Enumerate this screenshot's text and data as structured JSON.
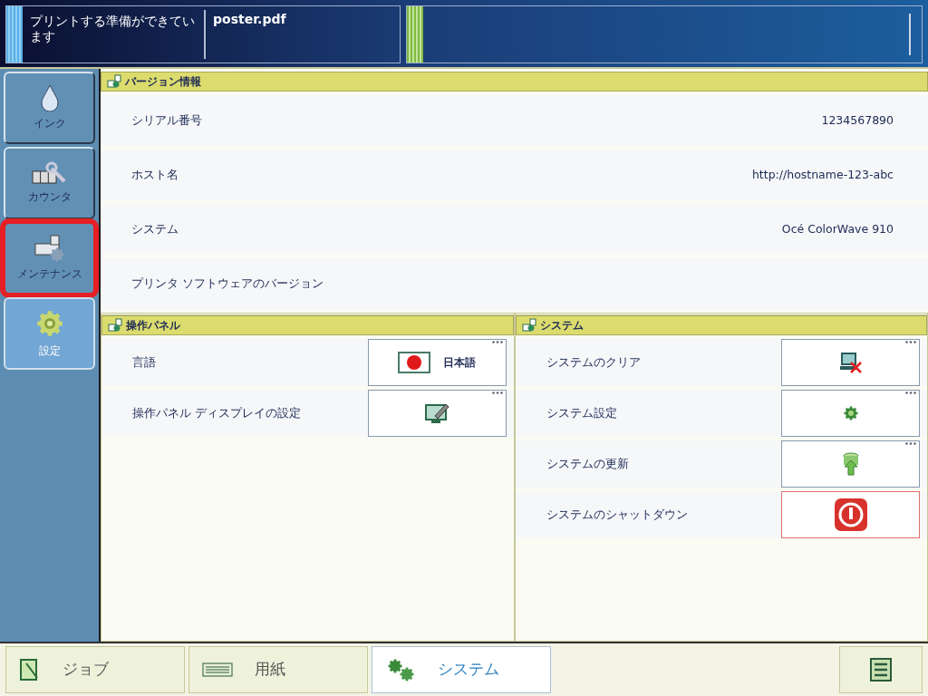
{
  "status_panel": {
    "message": "プリントする準備ができています",
    "job": "poster.pdf"
  },
  "sidebar": {
    "items": [
      {
        "label": "インク",
        "kind": "ink",
        "selected": false,
        "highlighted": false
      },
      {
        "label": "カウンタ",
        "kind": "counter",
        "selected": false,
        "highlighted": false
      },
      {
        "label": "メンテナンス",
        "kind": "maintenance",
        "selected": false,
        "highlighted": true
      },
      {
        "label": "設定",
        "kind": "settings",
        "selected": true,
        "highlighted": false
      }
    ]
  },
  "version_info": {
    "title": "バージョン情報",
    "rows": [
      {
        "label": "シリアル番号",
        "value": "1234567890"
      },
      {
        "label": "ホスト名",
        "value": "http://hostname-123-abc"
      },
      {
        "label": "システム",
        "value": "Océ ColorWave 910"
      },
      {
        "label": "プリンタ ソフトウェアのバージョン"
      }
    ]
  },
  "panels": [
    {
      "title": "操作パネル",
      "rows": [
        {
          "label": "言語",
          "button": {
            "kind": "flag",
            "text": "日本語",
            "more": true
          }
        },
        {
          "label": "操作パネル ディスプレイの設定",
          "button": {
            "kind": "display",
            "more": true
          }
        }
      ]
    },
    {
      "title": "システム",
      "rows": [
        {
          "label": "システムのクリア",
          "button": {
            "kind": "clear",
            "more": true
          }
        },
        {
          "label": "システム設定",
          "button": {
            "kind": "gear",
            "more": true
          }
        },
        {
          "label": "システムの更新",
          "button": {
            "kind": "update",
            "more": true
          }
        },
        {
          "label": "システムのシャットダウン",
          "button": {
            "kind": "shutdown",
            "more": false
          }
        }
      ]
    }
  ],
  "bottom_tabs": [
    {
      "label": "ジョブ",
      "kind": "job",
      "selected": false
    },
    {
      "label": "用紙",
      "kind": "paper",
      "selected": false
    },
    {
      "label": "システム",
      "kind": "system",
      "selected": true
    },
    {
      "kind": "menu",
      "selected": false
    }
  ]
}
